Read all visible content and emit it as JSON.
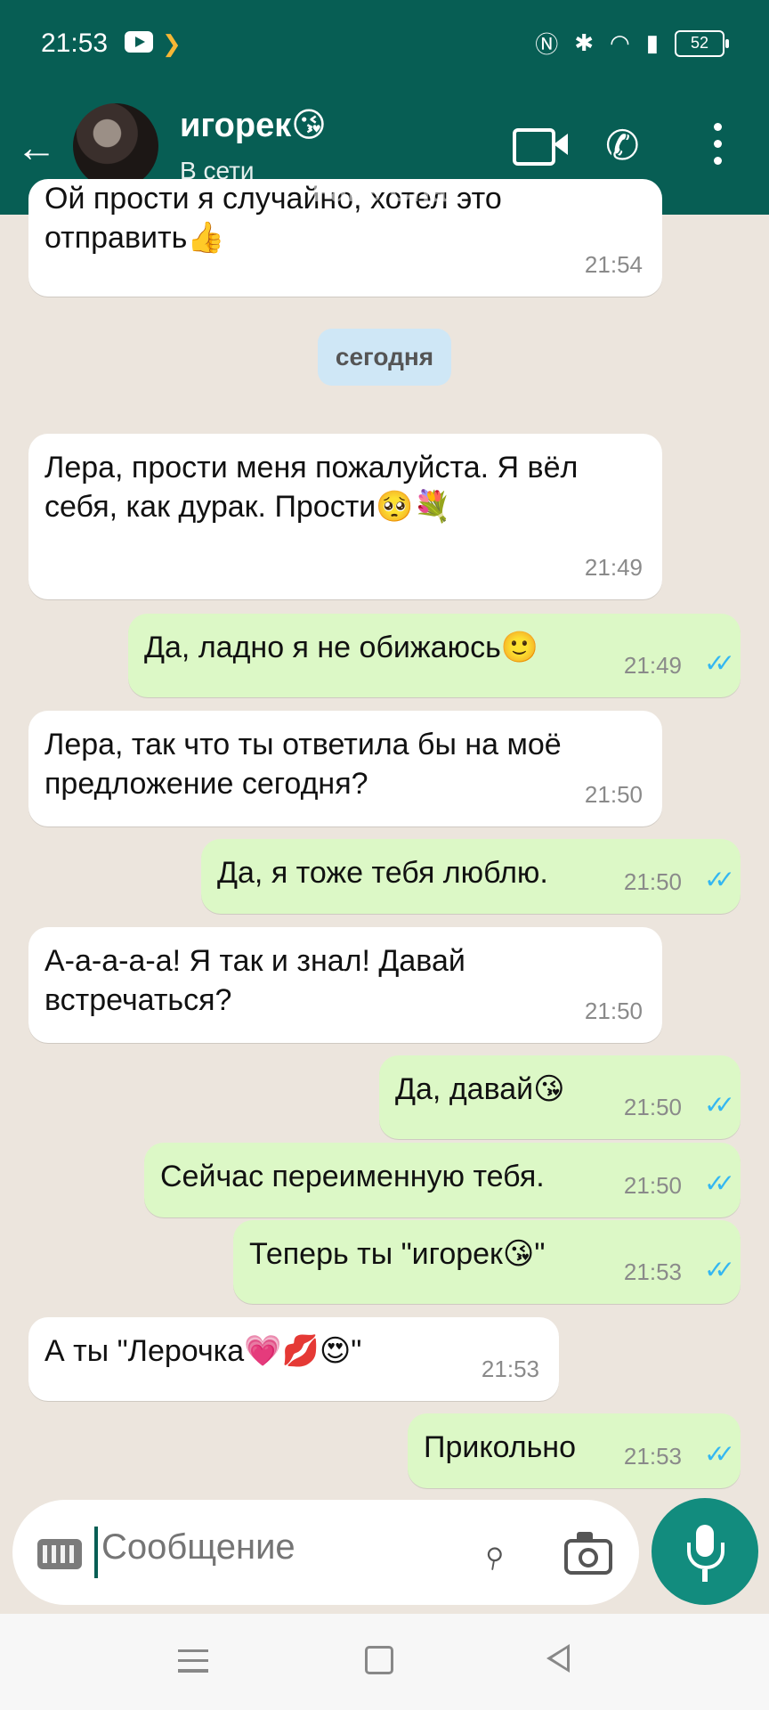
{
  "status_bar": {
    "time": "21:53",
    "battery": "52"
  },
  "header": {
    "contact_name": "игорек😘",
    "contact_status": "В сети",
    "watermark": "Fake Chat"
  },
  "chat": {
    "date_separator": "сегодня",
    "messages": [
      {
        "dir": "in",
        "text": "Ой прости я случайно, хотел это отправить👍",
        "time": "21:54"
      },
      {
        "dir": "in",
        "text": "Лера, прости меня пожалуйста. Я вёл себя, как дурак. Прости🥺💐",
        "time": "21:49"
      },
      {
        "dir": "out",
        "text": "Да, ладно я не обижаюсь🙂",
        "time": "21:49"
      },
      {
        "dir": "in",
        "text": "Лера, так что ты ответила бы на моё предложение сегодня?",
        "time": "21:50"
      },
      {
        "dir": "out",
        "text": "Да, я тоже тебя люблю.",
        "time": "21:50"
      },
      {
        "dir": "in",
        "text": "А-а-а-а-а! Я так и знал! Давай встречаться?",
        "time": "21:50"
      },
      {
        "dir": "out",
        "text": "Да, давай😘",
        "time": "21:50"
      },
      {
        "dir": "out",
        "text": "Сейчас переименную тебя.",
        "time": "21:50"
      },
      {
        "dir": "out",
        "text": "Теперь ты \"игорек😘\"",
        "time": "21:53"
      },
      {
        "dir": "in",
        "text": "А ты \"Лерочка💗💋😍\"",
        "time": "21:53"
      },
      {
        "dir": "out",
        "text": "Прикольно",
        "time": "21:53"
      }
    ]
  },
  "input": {
    "placeholder": "Сообщение"
  },
  "colors": {
    "header": "#075e54",
    "outgoing": "#dcf8c6",
    "incoming": "#ffffff",
    "mic": "#128c7e",
    "ticks": "#34b7f1"
  }
}
